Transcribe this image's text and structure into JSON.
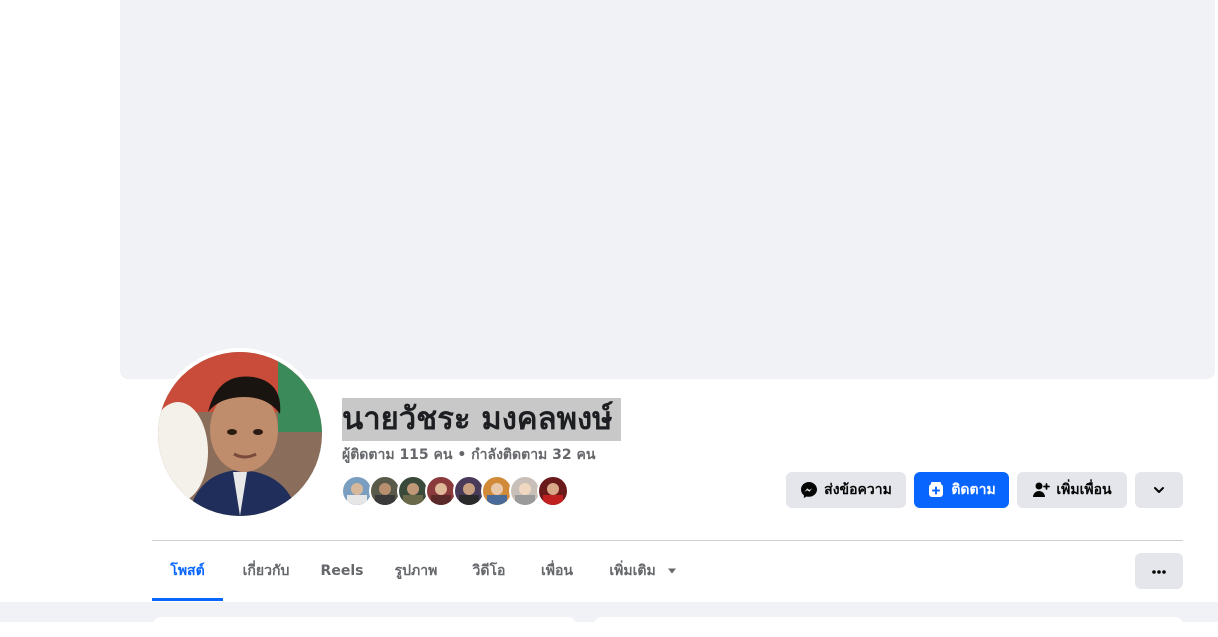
{
  "profile": {
    "name": "นายวัชระ มงคลพงษ์",
    "follow_stats": "ผู้ติดตาม 115 คน • กำลังติดตาม 32 คน"
  },
  "actions": {
    "message_label": "ส่งข้อความ",
    "follow_label": "ติดตาม",
    "add_friend_label": "เพิ่มเพื่อน"
  },
  "tabs": [
    {
      "label": "โพสต์",
      "active": true
    },
    {
      "label": "เกี่ยวกับ",
      "active": false
    },
    {
      "label": "Reels",
      "active": false
    },
    {
      "label": "รูปภาพ",
      "active": false
    },
    {
      "label": "วิดีโอ",
      "active": false
    },
    {
      "label": "เพื่อน",
      "active": false
    },
    {
      "label": "เพิ่มเติม",
      "active": false
    }
  ],
  "icons": {
    "messenger": "messenger-icon",
    "follow": "follow-icon",
    "add_friend": "add-friend-icon",
    "dropdown": "chevron-down-icon",
    "more": "ellipsis-icon",
    "tab_more_caret": "caret-down-icon"
  },
  "colors": {
    "accent": "#0866ff",
    "secondary_text": "#65676b",
    "button_gray": "#e4e6eb",
    "background": "#f0f2f5"
  }
}
